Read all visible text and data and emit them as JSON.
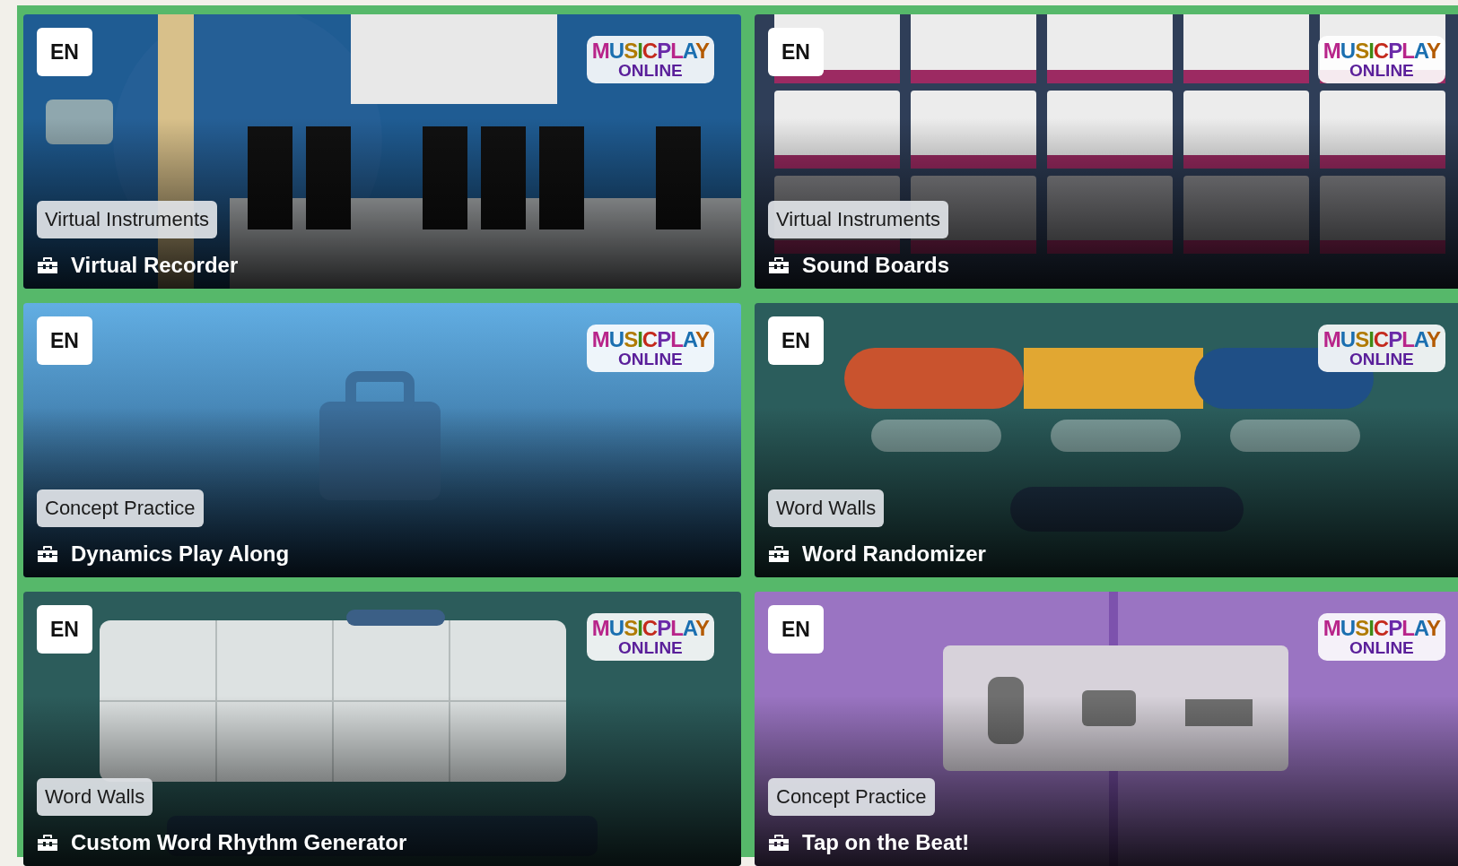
{
  "cards": [
    {
      "language": "EN",
      "logo": {
        "line1": "MUSICPLAY",
        "line2": "ONLINE"
      },
      "category": "Virtual Instruments",
      "title": "Virtual Recorder"
    },
    {
      "language": "EN",
      "logo": {
        "line1": "MUSICPLAY",
        "line2": "ONLINE"
      },
      "category": "Virtual Instruments",
      "title": "Sound Boards"
    },
    {
      "language": "EN",
      "logo": {
        "line1": "MUSICPLAY",
        "line2": "ONLINE"
      },
      "category": "Concept Practice",
      "title": "Dynamics Play Along"
    },
    {
      "language": "EN",
      "logo": {
        "line1": "MUSICPLAY",
        "line2": "ONLINE"
      },
      "category": "Word Walls",
      "title": "Word Randomizer"
    },
    {
      "language": "EN",
      "logo": {
        "line1": "MUSICPLAY",
        "line2": "ONLINE"
      },
      "category": "Word Walls",
      "title": "Custom Word Rhythm Generator"
    },
    {
      "language": "EN",
      "logo": {
        "line1": "MUSICPLAY",
        "line2": "ONLINE"
      },
      "category": "Concept Practice",
      "title": "Tap on the Beat!"
    }
  ]
}
